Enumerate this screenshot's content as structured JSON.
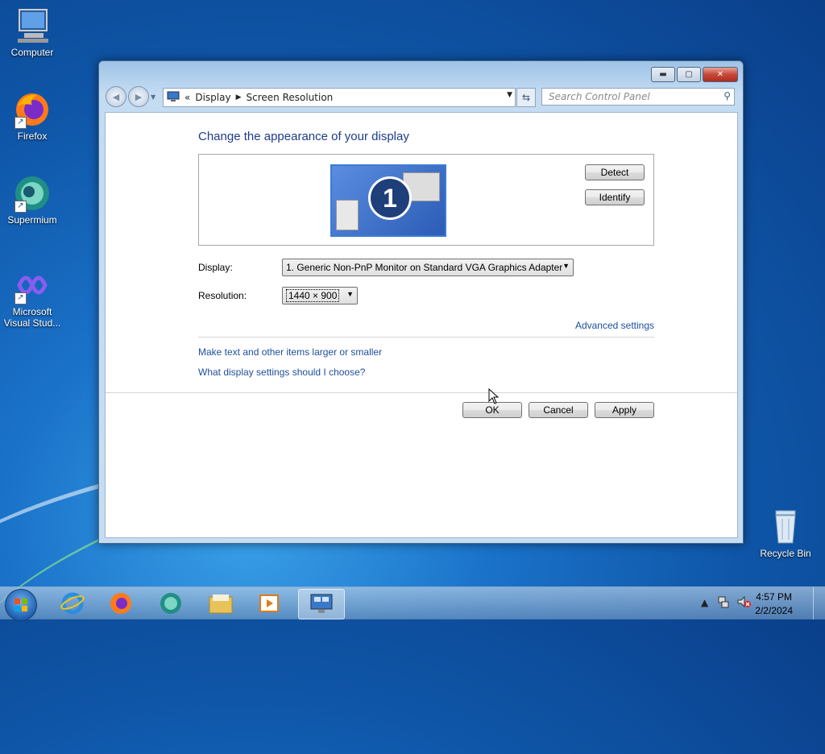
{
  "desktop": {
    "icons": [
      {
        "label": "Computer"
      },
      {
        "label": "Firefox"
      },
      {
        "label": "Supermium"
      },
      {
        "label": "Microsoft Visual Stud..."
      },
      {
        "label": "Recycle Bin"
      }
    ]
  },
  "window": {
    "breadcrumb": [
      "Display",
      "Screen Resolution"
    ],
    "search_placeholder": "Search Control Panel",
    "heading": "Change the appearance of your display",
    "monitor_number": "1",
    "detect_label": "Detect",
    "identify_label": "Identify",
    "display_label": "Display:",
    "display_value": "1. Generic Non-PnP Monitor on Standard VGA Graphics Adapter",
    "resolution_label": "Resolution:",
    "resolution_value": "1440 × 900",
    "advanced_link": "Advanced settings",
    "link_text_size": "Make text and other items larger or smaller",
    "link_which_settings": "What display settings should I choose?",
    "ok_label": "OK",
    "cancel_label": "Cancel",
    "apply_label": "Apply"
  },
  "taskbar": {
    "time": "4:57 PM",
    "date": "2/2/2024"
  },
  "colors": {
    "link": "#1e4e9c",
    "heading": "#1e3b8a"
  }
}
